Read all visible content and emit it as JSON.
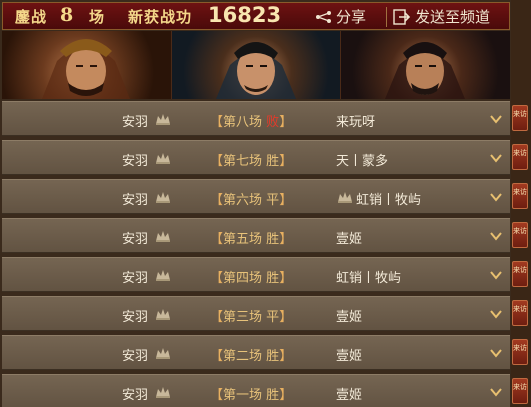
{
  "header": {
    "battle_prefix": "鏖战",
    "battle_count": "8",
    "battle_suffix": "场",
    "exploit_label": "新获战功",
    "exploit_value": "16823",
    "share_label": "分享",
    "send_label": "发送至频道"
  },
  "rows": [
    {
      "player": "安羽",
      "bracket_open": "【",
      "match": "第八场",
      "result": "败",
      "result_type": "lose",
      "bracket_close": "】",
      "opponent": "来玩呀",
      "opponent_emblem": false,
      "tab": "来访"
    },
    {
      "player": "安羽",
      "bracket_open": "【",
      "match": "第七场",
      "result": "胜",
      "result_type": "win",
      "bracket_close": "】",
      "opponent": "天丨蒙多",
      "opponent_emblem": false,
      "tab": "来访"
    },
    {
      "player": "安羽",
      "bracket_open": "【",
      "match": "第六场",
      "result": "平",
      "result_type": "draw",
      "bracket_close": "】",
      "opponent": "虹销丨牧屿",
      "opponent_emblem": true,
      "tab": "来访"
    },
    {
      "player": "安羽",
      "bracket_open": "【",
      "match": "第五场",
      "result": "胜",
      "result_type": "win",
      "bracket_close": "】",
      "opponent": "壹姬",
      "opponent_emblem": false,
      "tab": "来访"
    },
    {
      "player": "安羽",
      "bracket_open": "【",
      "match": "第四场",
      "result": "胜",
      "result_type": "win",
      "bracket_close": "】",
      "opponent": "虹销丨牧屿",
      "opponent_emblem": false,
      "tab": "来访"
    },
    {
      "player": "安羽",
      "bracket_open": "【",
      "match": "第三场",
      "result": "平",
      "result_type": "draw",
      "bracket_close": "】",
      "opponent": "壹姬",
      "opponent_emblem": false,
      "tab": "来访"
    },
    {
      "player": "安羽",
      "bracket_open": "【",
      "match": "第二场",
      "result": "胜",
      "result_type": "win",
      "bracket_close": "】",
      "opponent": "壹姬",
      "opponent_emblem": false,
      "tab": "来访"
    },
    {
      "player": "安羽",
      "bracket_open": "【",
      "match": "第一场",
      "result": "胜",
      "result_type": "win",
      "bracket_close": "】",
      "opponent": "壹姬",
      "opponent_emblem": false,
      "tab": "来访"
    }
  ],
  "colors": {
    "lose": "#e43a2a",
    "win": "#e7c27a",
    "accent": "#6e1212"
  },
  "icons": {
    "share": "share-icon",
    "send": "send-arrow-icon",
    "expand": "chevron-down-icon",
    "emblem": "rank-emblem-icon"
  }
}
